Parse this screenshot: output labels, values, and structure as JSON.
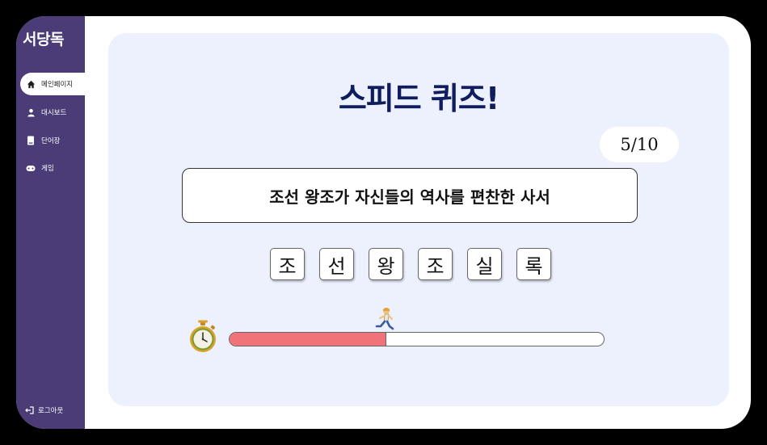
{
  "app": {
    "logo": "서당독"
  },
  "sidebar": {
    "items": [
      {
        "label": "메인페이지",
        "icon": "home-icon",
        "active": true
      },
      {
        "label": "대시보드",
        "icon": "person-icon",
        "active": false
      },
      {
        "label": "단어장",
        "icon": "book-icon",
        "active": false
      },
      {
        "label": "게임",
        "icon": "gamepad-icon",
        "active": false
      }
    ],
    "logout_label": "로그아웃"
  },
  "quiz": {
    "title": "스피드 퀴즈!",
    "progress": "5/10",
    "question": "조선 왕조가 자신들의 역사를 편찬한 사서",
    "answer_tiles": [
      "조",
      "선",
      "왕",
      "조",
      "실",
      "록"
    ],
    "timer_fraction": 0.42
  },
  "colors": {
    "sidebar": "#4b3b76",
    "panel": "#edf1fe",
    "title": "#0f1d5e",
    "timer_fill": "#f07379"
  }
}
